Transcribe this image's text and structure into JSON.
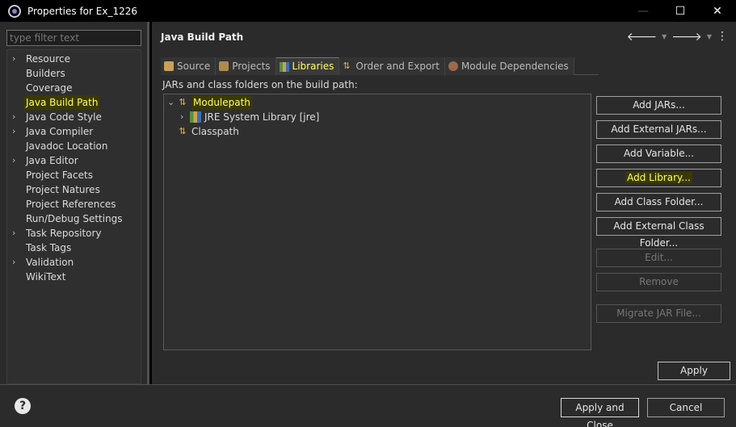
{
  "window": {
    "title": "Properties for Ex_1226",
    "minimize": "—",
    "maximize": "☐",
    "close": "✕"
  },
  "sidebar": {
    "filter_placeholder": "type filter text",
    "items": [
      {
        "label": "Resource",
        "expandable": true,
        "selected": false
      },
      {
        "label": "Builders",
        "expandable": false,
        "selected": false
      },
      {
        "label": "Coverage",
        "expandable": false,
        "selected": false
      },
      {
        "label": "Java Build Path",
        "expandable": false,
        "selected": true
      },
      {
        "label": "Java Code Style",
        "expandable": true,
        "selected": false
      },
      {
        "label": "Java Compiler",
        "expandable": true,
        "selected": false
      },
      {
        "label": "Javadoc Location",
        "expandable": false,
        "selected": false
      },
      {
        "label": "Java Editor",
        "expandable": true,
        "selected": false
      },
      {
        "label": "Project Facets",
        "expandable": false,
        "selected": false
      },
      {
        "label": "Project Natures",
        "expandable": false,
        "selected": false
      },
      {
        "label": "Project References",
        "expandable": false,
        "selected": false
      },
      {
        "label": "Run/Debug Settings",
        "expandable": false,
        "selected": false
      },
      {
        "label": "Task Repository",
        "expandable": true,
        "selected": false
      },
      {
        "label": "Task Tags",
        "expandable": false,
        "selected": false
      },
      {
        "label": "Validation",
        "expandable": true,
        "selected": false
      },
      {
        "label": "WikiText",
        "expandable": false,
        "selected": false
      }
    ]
  },
  "main": {
    "title": "Java Build Path",
    "tabs": [
      {
        "label": "Source",
        "icon": "source-folder-icon",
        "active": false
      },
      {
        "label": "Projects",
        "icon": "projects-folder-icon",
        "active": false
      },
      {
        "label": "Libraries",
        "icon": "libraries-icon",
        "active": true
      },
      {
        "label": "Order and Export",
        "icon": "order-export-icon",
        "active": false
      },
      {
        "label": "Module Dependencies",
        "icon": "module-icon",
        "active": false
      }
    ],
    "subtitle": "JARs and class folders on the build path:",
    "tree": {
      "modulepath": "Modulepath",
      "jre": "JRE System Library [jre]",
      "classpath": "Classpath"
    },
    "buttons": {
      "add_jars": "Add JARs...",
      "add_external_jars": "Add External JARs...",
      "add_variable": "Add Variable...",
      "add_library": "Add Library...",
      "add_class_folder": "Add Class Folder...",
      "add_external_class_folder": "Add External Class Folder...",
      "edit": "Edit...",
      "remove": "Remove",
      "migrate_jar": "Migrate JAR File..."
    },
    "apply": "Apply"
  },
  "footer": {
    "help": "?",
    "apply_and_close": "Apply and Close",
    "cancel": "Cancel"
  }
}
